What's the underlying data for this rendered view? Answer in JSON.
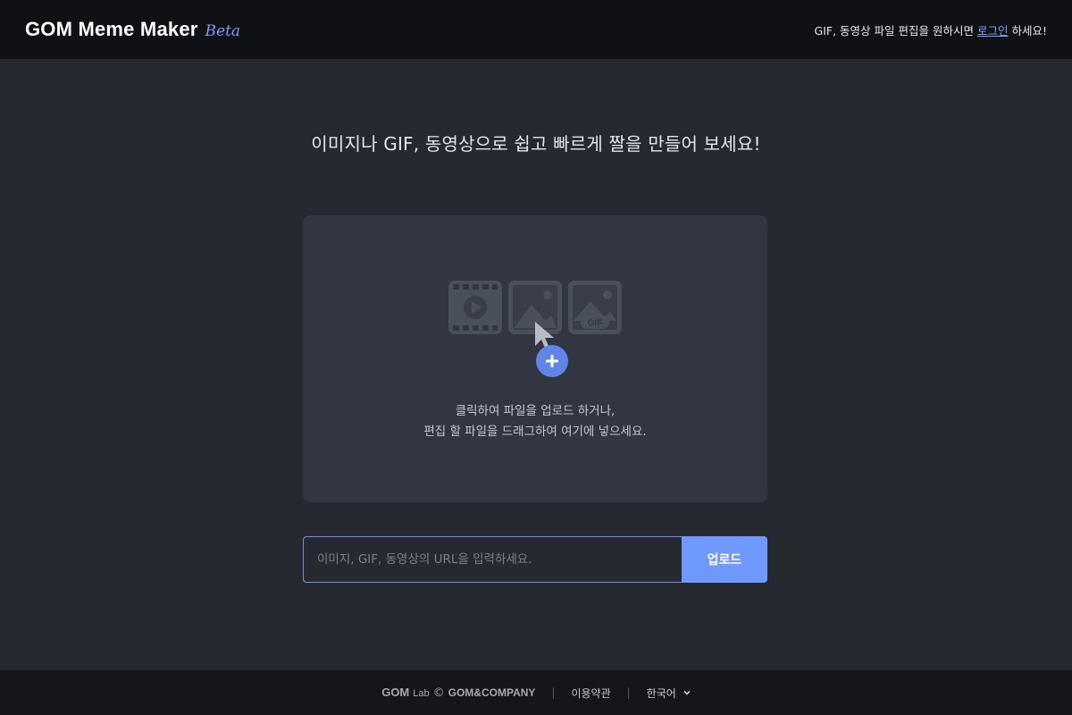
{
  "header": {
    "logo_text": "GOM Meme Maker",
    "logo_beta": "Beta",
    "message_before": "GIF, 동영상 파일 편집을 원하시면",
    "login_link": "로그인",
    "message_after": "하세요!"
  },
  "main": {
    "headline": "이미지나 GIF, 동영상으로 쉽고 빠르게 짤을 만들어 보세요!",
    "dropzone": {
      "line1": "클릭하여 파일을 업로드 하거나,",
      "line2": "편집 할 파일을 드래그하여 여기에 넣으세요.",
      "gif_badge": "GIF"
    },
    "url_input": {
      "placeholder": "이미지, GIF, 동영상의 URL을 입력하세요.",
      "value": ""
    },
    "upload_button": "업로드"
  },
  "footer": {
    "brand_gom": "GOM",
    "brand_lab": "Lab",
    "brand_copy": "©",
    "brand_company": "GOM&COMPANY",
    "separator": "|",
    "terms": "이용약관",
    "language": "한국어"
  },
  "colors": {
    "background": "#262930",
    "header_bg": "#0f1115",
    "dropzone_bg": "#323643",
    "accent": "#6f99ff",
    "beta": "#7a9df7"
  },
  "icons": [
    "video-icon",
    "image-icon",
    "gif-image-icon",
    "cursor-icon",
    "plus-icon",
    "chevron-down-icon"
  ]
}
